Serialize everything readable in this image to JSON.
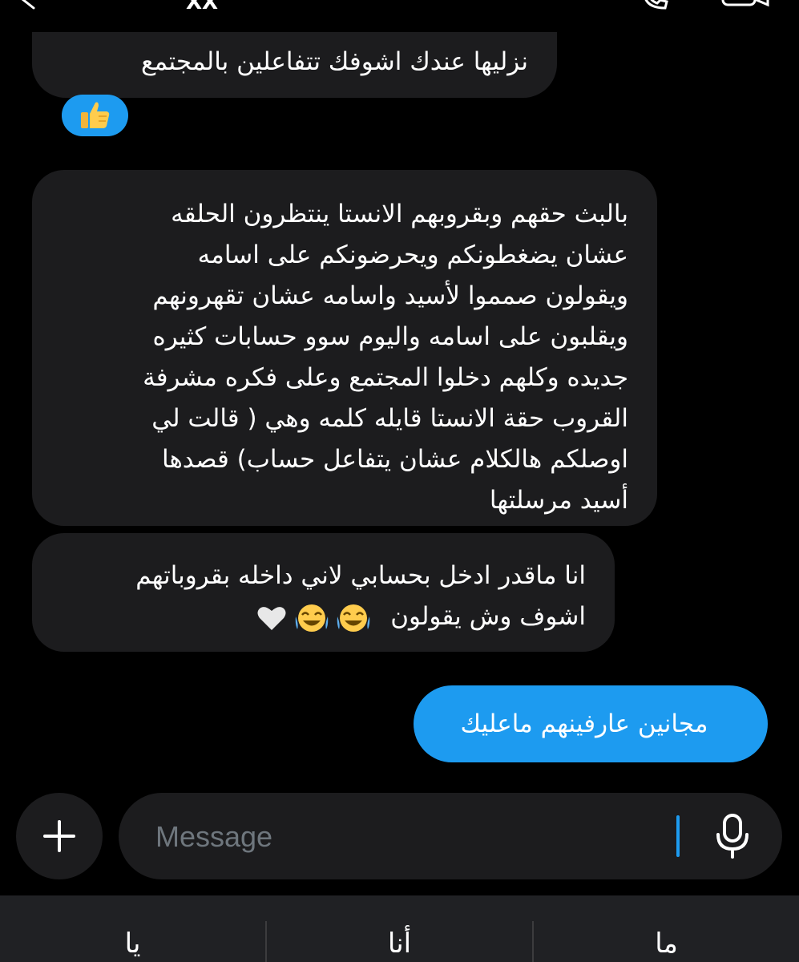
{
  "header": {
    "title": "XX"
  },
  "messages": [
    {
      "direction": "received",
      "lines": [
        "نزليها عندك اشوفك تتفاعلين بالمجتمع"
      ],
      "reaction": "thumbs-up"
    },
    {
      "direction": "received",
      "lines": [
        "بالبث حقهم وبقروبهم الانستا ينتظرون الحلقه",
        "عشان يضغطونكم ويحرضونكم على اسامه",
        "ويقولون صمموا لأسيد واسامه عشان تقهرونهم",
        "ويقلبون على اسامه واليوم سوو حسابات كثيره",
        "جديده وكلهم دخلوا المجتمع وعلى فكره مشرفة",
        "القروب حقة الانستا قايله كلمه وهي ( قالت لي",
        "اوصلكم هالكلام عشان يتفاعل حساب) قصدها",
        "أسيد مرسلتها"
      ]
    },
    {
      "direction": "received",
      "lines": [
        "انا ماقدر ادخل بحسابي لاني داخله بقروباتهم",
        "اشوف وش يقولون"
      ],
      "emojis": [
        "laughing-crying-face",
        "laughing-crying-face",
        "white-heart"
      ]
    },
    {
      "direction": "sent",
      "lines": [
        "مجانين عارفينهم ماعليك"
      ]
    }
  ],
  "composer": {
    "placeholder": "Message",
    "plus_icon": "plus-icon",
    "mic_icon": "microphone-icon"
  },
  "suggestions": [
    "ما",
    "أنا",
    "يا"
  ],
  "colors": {
    "background": "#000000",
    "received_bubble": "#1c1c1e",
    "sent_bubble": "#1d9bf0",
    "placeholder": "#6e767d"
  }
}
